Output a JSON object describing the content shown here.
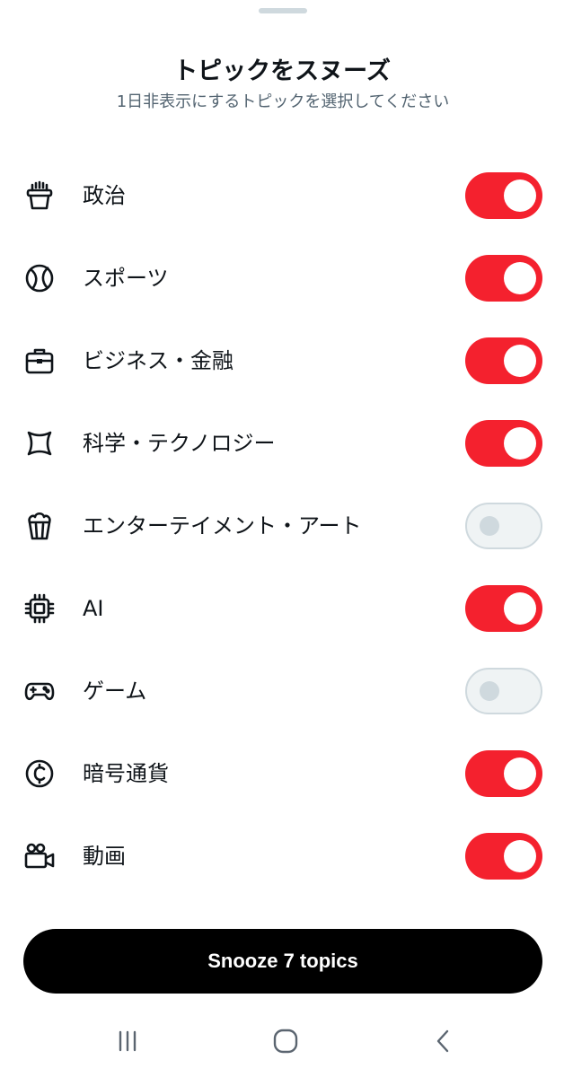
{
  "sheet": {
    "title": "トピックをスヌーズ",
    "subtitle": "1日非表示にするトピックを選択してください"
  },
  "topics": [
    {
      "label": "政治",
      "icon": "podium-icon",
      "enabled": true
    },
    {
      "label": "スポーツ",
      "icon": "tennis-ball-icon",
      "enabled": true
    },
    {
      "label": "ビジネス・金融",
      "icon": "briefcase-icon",
      "enabled": true
    },
    {
      "label": "科学・テクノロジー",
      "icon": "atom-icon",
      "enabled": true
    },
    {
      "label": "エンターテイメント・アート",
      "icon": "popcorn-icon",
      "enabled": false
    },
    {
      "label": "AI",
      "icon": "chip-icon",
      "enabled": true
    },
    {
      "label": "ゲーム",
      "icon": "gamepad-icon",
      "enabled": false
    },
    {
      "label": "暗号通貨",
      "icon": "coin-icon",
      "enabled": true
    },
    {
      "label": "動画",
      "icon": "video-camera-icon",
      "enabled": true
    }
  ],
  "snooze_button": {
    "label": "Snooze 7 topics"
  },
  "nav": {
    "recents": "recent-apps-icon",
    "home": "home-icon",
    "back": "back-icon"
  },
  "colors": {
    "toggle_on": "#f4212e",
    "toggle_off": "#eff3f4",
    "button": "#000000",
    "subtitle": "#536471"
  }
}
